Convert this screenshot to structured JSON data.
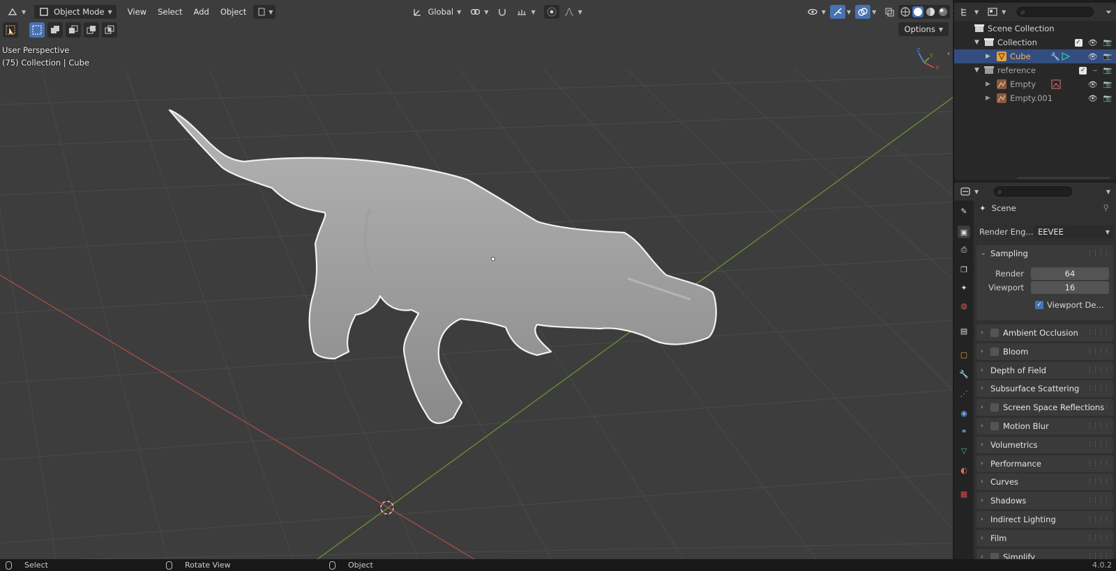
{
  "viewport": {
    "mode_label": "Object Mode",
    "menus": [
      "View",
      "Select",
      "Add",
      "Object"
    ],
    "orientation_label": "Global",
    "options_label": "Options",
    "perspective_label": "User Perspective",
    "collection_info": "(75) Collection | Cube",
    "gizmo_axes": [
      "X",
      "Y",
      "Z"
    ]
  },
  "outliner": {
    "root": "Scene Collection",
    "rows": [
      {
        "label": "Collection",
        "kind": "collection"
      },
      {
        "label": "Cube",
        "kind": "mesh",
        "selected": true
      },
      {
        "label": "reference",
        "kind": "collection"
      },
      {
        "label": "Empty",
        "kind": "empty"
      },
      {
        "label": "Empty.001",
        "kind": "empty"
      }
    ]
  },
  "properties": {
    "context": "Scene",
    "render_engine_label": "Render Eng...",
    "render_engine_value": "EEVEE",
    "sampling": {
      "title": "Sampling",
      "render_label": "Render",
      "render_value": "64",
      "viewport_label": "Viewport",
      "viewport_value": "16",
      "denoise_label": "Viewport De..."
    },
    "panels": [
      {
        "label": "Ambient Occlusion",
        "checkbox": true
      },
      {
        "label": "Bloom",
        "checkbox": true
      },
      {
        "label": "Depth of Field",
        "checkbox": false
      },
      {
        "label": "Subsurface Scattering",
        "checkbox": false
      },
      {
        "label": "Screen Space Reflections",
        "checkbox": true
      },
      {
        "label": "Motion Blur",
        "checkbox": true
      },
      {
        "label": "Volumetrics",
        "checkbox": false
      },
      {
        "label": "Performance",
        "checkbox": false
      },
      {
        "label": "Curves",
        "checkbox": false
      },
      {
        "label": "Shadows",
        "checkbox": false
      },
      {
        "label": "Indirect Lighting",
        "checkbox": false
      },
      {
        "label": "Film",
        "checkbox": false
      },
      {
        "label": "Simplify",
        "checkbox": true
      }
    ]
  },
  "statusbar": {
    "select": "Select",
    "rotate": "Rotate View",
    "object": "Object",
    "version": "4.0.2"
  },
  "colors": {
    "selection_blue": "#334d80",
    "accent_orange": "#e8a33d",
    "x_axis": "#c94848",
    "y_axis": "#6f9a2e"
  }
}
